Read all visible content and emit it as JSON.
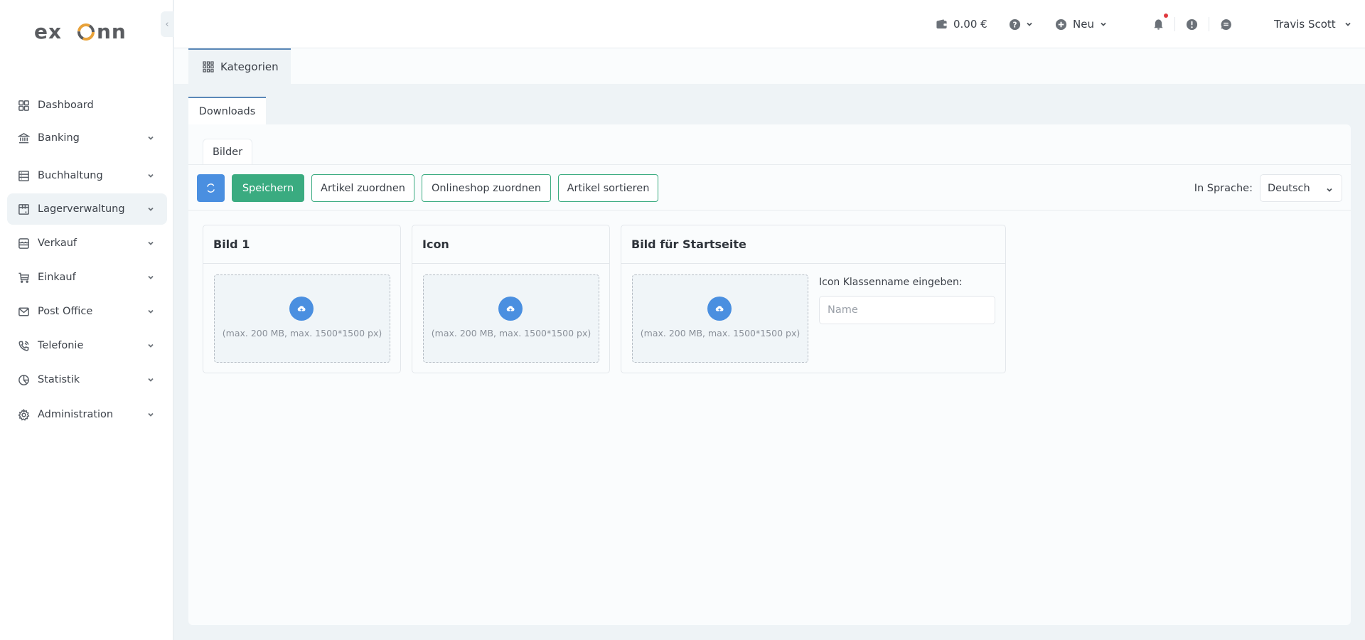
{
  "brand": {
    "logo_text": "exonn",
    "accent": "#e8a23a"
  },
  "sidebar": {
    "collapse_label": "‹",
    "items": [
      {
        "label": "Dashboard",
        "icon": "dashboard-icon",
        "has_children": false,
        "active": false
      },
      {
        "label": "Banking",
        "icon": "bank-icon",
        "has_children": true,
        "active": false
      },
      {
        "label": "Buchhaltung",
        "icon": "ledger-icon",
        "has_children": true,
        "active": false
      },
      {
        "label": "Lagerverwaltung",
        "icon": "warehouse-icon",
        "has_children": true,
        "active": true
      },
      {
        "label": "Verkauf",
        "icon": "store-icon",
        "has_children": true,
        "active": false
      },
      {
        "label": "Einkauf",
        "icon": "cart-icon",
        "has_children": true,
        "active": false
      },
      {
        "label": "Post Office",
        "icon": "mail-icon",
        "has_children": true,
        "active": false
      },
      {
        "label": "Telefonie",
        "icon": "phone-icon",
        "has_children": true,
        "active": false
      },
      {
        "label": "Statistik",
        "icon": "pie-chart-icon",
        "has_children": true,
        "active": false
      },
      {
        "label": "Administration",
        "icon": "gear-icon",
        "has_children": true,
        "active": false
      }
    ]
  },
  "topbar": {
    "balance": "0.00 €",
    "new_label": "Neu",
    "user_name": "Travis Scott",
    "has_notification": true
  },
  "page_tabs": [
    {
      "label": "Kategorien",
      "icon": "grid-icon"
    }
  ],
  "sub_tabs": [
    {
      "label": "Downloads"
    }
  ],
  "inner_tabs": [
    {
      "label": "Bilder"
    }
  ],
  "toolbar": {
    "save_label": "Speichern",
    "assign_articles_label": "Artikel zuordnen",
    "assign_shop_label": "Onlineshop zuordnen",
    "sort_articles_label": "Artikel sortieren",
    "language_label": "In Sprache:",
    "language_value": "Deutsch"
  },
  "cards": [
    {
      "title": "Bild 1",
      "hint": "(max. 200 MB, max. 1500*1500 px)"
    },
    {
      "title": "Icon",
      "hint": "(max. 200 MB, max. 1500*1500 px)"
    },
    {
      "title": "Bild für Startseite",
      "hint": "(max. 200 MB, max. 1500*1500 px)",
      "field_label": "Icon Klassenname eingeben:",
      "field_placeholder": "Name",
      "field_value": ""
    }
  ],
  "colors": {
    "primary_blue": "#4a8fe0",
    "success_green": "#3aab80",
    "tab_indicator": "#5a88b8",
    "notification_red": "#e0393e"
  }
}
